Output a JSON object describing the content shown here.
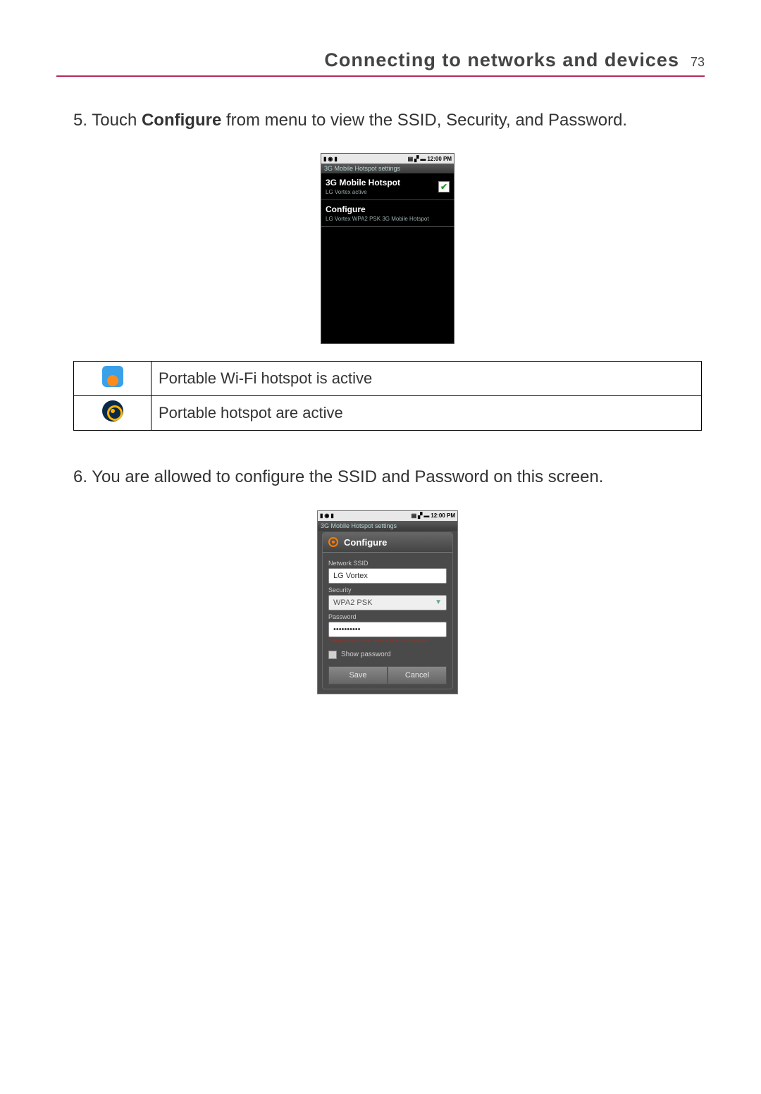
{
  "header": {
    "title": "Connecting to networks and devices",
    "page": "73"
  },
  "step5": {
    "num": "5.",
    "pre": "Touch ",
    "bold": "Configure",
    "post": " from menu to view the SSID, Security, and Password."
  },
  "phone1": {
    "time": "12:00 PM",
    "titlebar": "3G Mobile Hotspot settings",
    "item1": {
      "primary": "3G Mobile Hotspot",
      "secondary": "LG Vortex active"
    },
    "item2": {
      "primary": "Configure",
      "secondary": "LG Vortex WPA2 PSK 3G Mobile Hotspot"
    }
  },
  "legend": {
    "row1": "Portable Wi-Fi hotspot is active",
    "row2": "Portable hotspot are active"
  },
  "step6": {
    "num": "6.",
    "text": "You are allowed to configure the SSID and Password on this screen."
  },
  "phone2": {
    "time": "12:00 PM",
    "titlebar": "3G Mobile Hotspot settings",
    "dlg_title": "Configure",
    "ssid_label": "Network SSID",
    "ssid_value": "LG Vortex",
    "security_label": "Security",
    "security_value": "WPA2 PSK",
    "password_label": "Password",
    "password_value": "••••••••••",
    "hint": "The password must have at least 8 characters",
    "show_pw": "Show password",
    "save": "Save",
    "cancel": "Cancel"
  }
}
